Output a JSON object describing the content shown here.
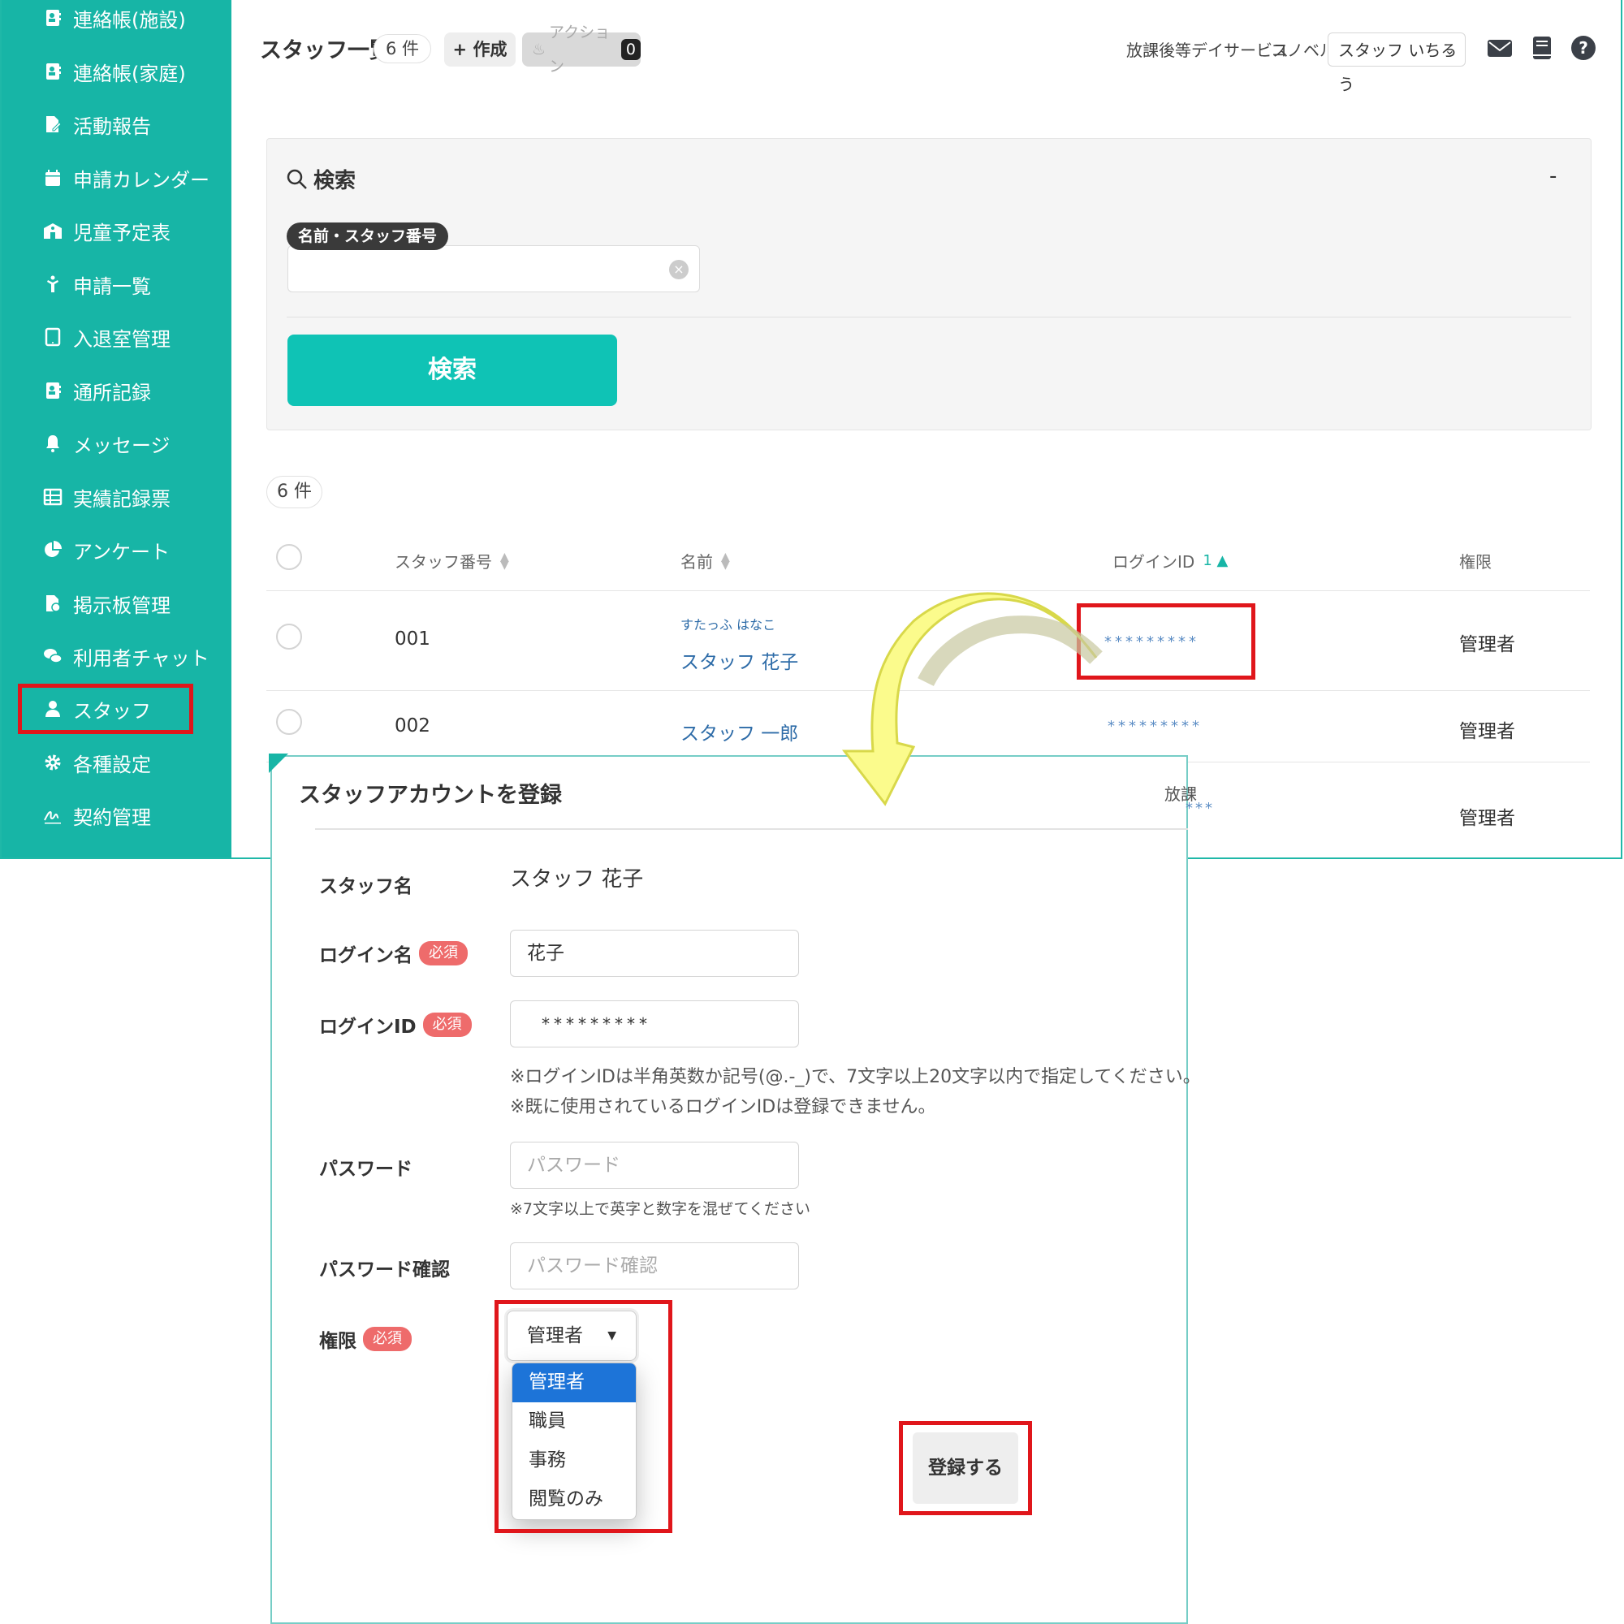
{
  "sidebar": {
    "items": [
      {
        "label": "連絡帳(施設)",
        "icon": "contact-book-icon"
      },
      {
        "label": "連絡帳(家庭)",
        "icon": "contact-book-icon"
      },
      {
        "label": "活動報告",
        "icon": "file-edit-icon"
      },
      {
        "label": "申請カレンダー",
        "icon": "calendar-icon"
      },
      {
        "label": "児童予定表",
        "icon": "school-icon"
      },
      {
        "label": "申請一覧",
        "icon": "child-icon"
      },
      {
        "label": "入退室管理",
        "icon": "tablet-icon"
      },
      {
        "label": "通所記録",
        "icon": "contact-book-icon"
      },
      {
        "label": "メッセージ",
        "icon": "bell-icon"
      },
      {
        "label": "実績記録票",
        "icon": "table-icon"
      },
      {
        "label": "アンケート",
        "icon": "pie-chart-icon"
      },
      {
        "label": "掲示板管理",
        "icon": "file-image-icon"
      },
      {
        "label": "利用者チャット",
        "icon": "chat-icon"
      },
      {
        "label": "スタッフ",
        "icon": "user-icon"
      },
      {
        "label": "各種設定",
        "icon": "gear-icon"
      },
      {
        "label": "契約管理",
        "icon": "signature-icon"
      }
    ]
  },
  "header": {
    "title": "スタッフ一覧",
    "count": "6 件",
    "create_label": "+ 作成",
    "action_label": "アクション",
    "action_count": "0",
    "facility": "放課後等デイサービス",
    "brand": "コノベル",
    "user": "スタッフ いちろう",
    "icons": [
      "mail-icon",
      "book-icon",
      "help-icon"
    ]
  },
  "search": {
    "title": "検索",
    "collapse": "-",
    "field_label": "名前・スタッフ番号",
    "value": "",
    "button": "検索"
  },
  "results": {
    "count": "6 件",
    "columns": [
      "スタッフ番号",
      "名前",
      "ログインID",
      "権限"
    ],
    "login_sort_index": "1",
    "rows": [
      {
        "number": "001",
        "kana": "すたっふ はなこ",
        "name": "スタッフ 花子",
        "login": "*********",
        "role": "管理者"
      },
      {
        "number": "002",
        "kana": "",
        "name": "スタッフ 一郎",
        "login": "*********",
        "role": "管理者"
      },
      {
        "number": "",
        "kana": "",
        "name": "",
        "login": "***",
        "role": "管理者"
      }
    ]
  },
  "modal": {
    "title": "スタッフアカウントを登録",
    "peek_text": "放課",
    "staff_name_label": "スタッフ名",
    "staff_name_value": "スタッフ 花子",
    "required": "必須",
    "login_name_label": "ログイン名",
    "login_name_value": "花子",
    "login_id_label": "ログインID",
    "login_id_value": "*********",
    "login_id_note1": "※ログインIDは半角英数か記号(@.-_)で、7文字以上20文字以内で指定してください。",
    "login_id_note2": "※既に使用されているログインIDは登録できません。",
    "password_label": "パスワード",
    "password_placeholder": "パスワード",
    "password_note": "※7文字以上で英字と数字を混ぜてください",
    "password_confirm_label": "パスワード確認",
    "password_confirm_placeholder": "パスワード確認",
    "role_label": "権限",
    "role_value": "管理者",
    "role_options": [
      "管理者",
      "職員",
      "事務",
      "閲覧のみ"
    ],
    "submit": "登録する"
  },
  "colors": {
    "sidebar": "#17b5a6",
    "primary_button": "#0fc3b5",
    "highlight": "#e0161b",
    "required_badge": "#ee6b6b",
    "option_selected": "#1d74d8",
    "callout_arrow": "#fbfb8c"
  }
}
